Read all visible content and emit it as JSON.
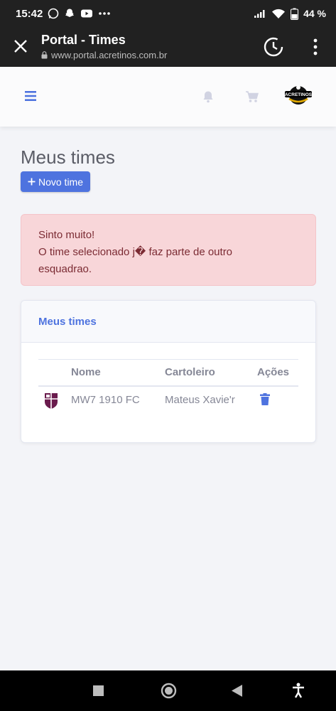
{
  "status_bar": {
    "time": "15:42",
    "battery": "44 %",
    "icons": [
      "whatsapp-icon",
      "snapchat-icon",
      "youtube-icon",
      "more-dots-icon",
      "signal-icon",
      "wifi-icon",
      "battery-icon"
    ]
  },
  "browser": {
    "title": "Portal - Times",
    "url": "www.portal.acretinos.com.br",
    "icons": [
      "close-icon",
      "lock-icon",
      "history-timer-icon",
      "more-vert-icon"
    ]
  },
  "site_header": {
    "icons": [
      "hamburger-icon",
      "bell-icon",
      "cart-icon",
      "acretinos-logo"
    ],
    "logo_text": "ACRETINOS"
  },
  "page": {
    "title": "Meus times",
    "new_button_label": "Novo time",
    "new_button_icon": "plus-icon"
  },
  "alert": {
    "line1": "Sinto muito!",
    "line2": "O time selecionado j� faz parte de outro",
    "line3": "esquadrao."
  },
  "card": {
    "title": "Meus times",
    "columns": [
      "Nome",
      "Cartoleiro",
      "Ações"
    ],
    "rows": [
      {
        "shield_icon": "team-shield-icon",
        "name": "MW7 1910 FC",
        "owner": "Mateus Xavie'r",
        "action_icon": "trash-icon"
      }
    ]
  },
  "colors": {
    "accent": "#4e73df",
    "alert_bg": "#f8d6d9",
    "alert_text": "#7b2b33",
    "team_shield": "#6a1b4d"
  },
  "nav_bar": {
    "icons": [
      "recents-square-icon",
      "home-circle-icon",
      "back-triangle-icon",
      "accessibility-icon"
    ]
  }
}
